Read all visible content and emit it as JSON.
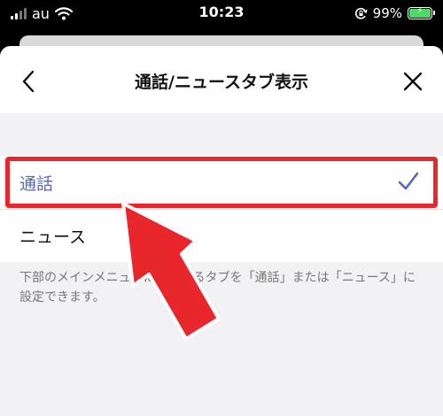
{
  "status_bar": {
    "carrier": "au",
    "time": "10:23",
    "battery_percent": "99%",
    "battery_level": 0.99,
    "icons": [
      "signal-icon",
      "wifi-icon",
      "orientation-lock-icon",
      "battery-charging-icon"
    ]
  },
  "header": {
    "title": "通話/ニュースタブ表示",
    "back_icon": "chevron-left-icon",
    "close_icon": "close-icon"
  },
  "options": [
    {
      "label": "通話",
      "selected": true
    },
    {
      "label": "ニュース",
      "selected": false
    }
  ],
  "description": "下部のメインメニューに表示するタブを「通話」または「ニュース」に設定できます。",
  "colors": {
    "accent": "#5a67b8",
    "highlight": "#e8262b",
    "sheet_bg": "#f2f2f4",
    "battery": "#4cd964"
  },
  "annotations": {
    "highlight_target": "通話",
    "pointer": "red-arrow"
  }
}
